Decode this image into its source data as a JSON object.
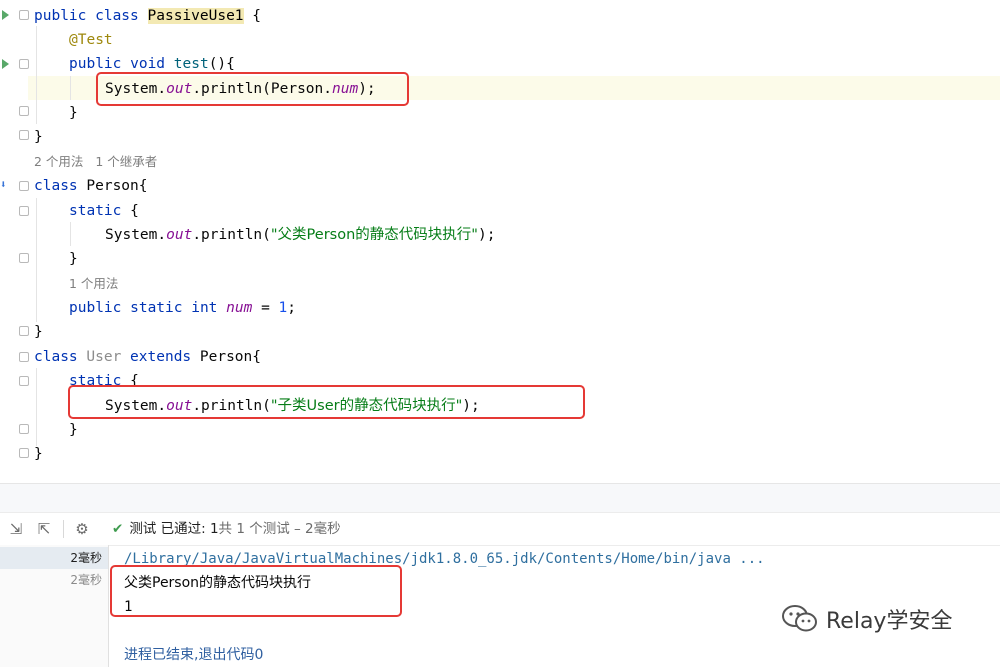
{
  "editor": {
    "code_lines": {
      "l1": {
        "kw": "public class ",
        "cls": "PassiveUse1",
        "rest": " {"
      },
      "l2": {
        "ann": "@Test"
      },
      "l3": {
        "kw": "public void ",
        "name": "test",
        "rest": "(){"
      },
      "l4": {
        "a": "System.",
        "b": "out",
        "c": ".println(Person.",
        "d": "num",
        "e": ");"
      },
      "l5": {
        "t": "}"
      },
      "l6": {
        "t": "}"
      },
      "hint1": "2 个用法   1 个继承者",
      "l7": {
        "kw": "class ",
        "rest": "Person{"
      },
      "l8": {
        "kw": "static",
        "rest": " {"
      },
      "l9": {
        "a": "System.",
        "b": "out",
        "c": ".println(",
        "s": "\"父类Person的静态代码块执行\"",
        "e": ");"
      },
      "l10": {
        "t": "}"
      },
      "hint2": "1 个用法",
      "l11": {
        "kw": "public static int ",
        "var": "num",
        "mid": " = ",
        "num": "1",
        "e": ";"
      },
      "l12": {
        "t": "}"
      },
      "l13": {
        "kw": "class ",
        "dim": "User ",
        "kw2": "extends ",
        "rest": "Person{"
      },
      "l14": {
        "kw": "static",
        "rest": " {"
      },
      "l15": {
        "a": "System.",
        "b": "out",
        "c": ".println(",
        "s": "\"子类User的静态代码块执行\"",
        "e": ");"
      },
      "l16": {
        "t": "}"
      },
      "l17": {
        "t": "}"
      }
    }
  },
  "run_panel": {
    "status_prefix": "测试 已通过: ",
    "status_count": "1",
    "status_suffix": "共 1 个测试 – 2毫秒",
    "tree": [
      "2毫秒",
      "2毫秒"
    ],
    "output": {
      "path": "/Library/Java/JavaVirtualMachines/jdk1.8.0_65.jdk/Contents/Home/bin/java ...",
      "line1": "父类Person的静态代码块执行",
      "line2": "1",
      "exit": "进程已结束,退出代码0"
    }
  },
  "watermark": "Relay学安全",
  "icons": [
    "run-icon",
    "fold-icon",
    "collapse-icon",
    "expand-icon",
    "gear-icon",
    "check-icon",
    "wechat-icon"
  ],
  "colors": {
    "keyword": "#0033b3",
    "string": "#067d17",
    "field": "#871094",
    "annotation": "#9e880d",
    "highlight_box": "#e53935",
    "pass": "#3f9c4f"
  }
}
